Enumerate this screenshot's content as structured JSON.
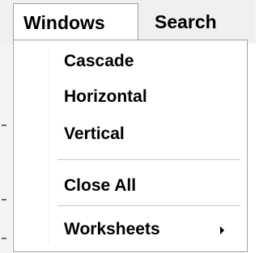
{
  "menubar": {
    "menus": [
      {
        "label": "Windows",
        "state": "open"
      },
      {
        "label": "Search"
      }
    ]
  },
  "dropdown": {
    "items": [
      {
        "label": "Cascade"
      },
      {
        "label": "Horizontal"
      },
      {
        "label": "Vertical"
      },
      {
        "label": "Close All"
      },
      {
        "label": "Worksheets",
        "has_submenu": true,
        "submenu_icon": "chevron-right-icon"
      }
    ]
  },
  "colors": {
    "menubar_bg": "#f0f0f0",
    "dropdown_bg": "#ffffff",
    "border": "#a0a0a0",
    "separator": "#c8c8c8",
    "text": "#000000"
  }
}
